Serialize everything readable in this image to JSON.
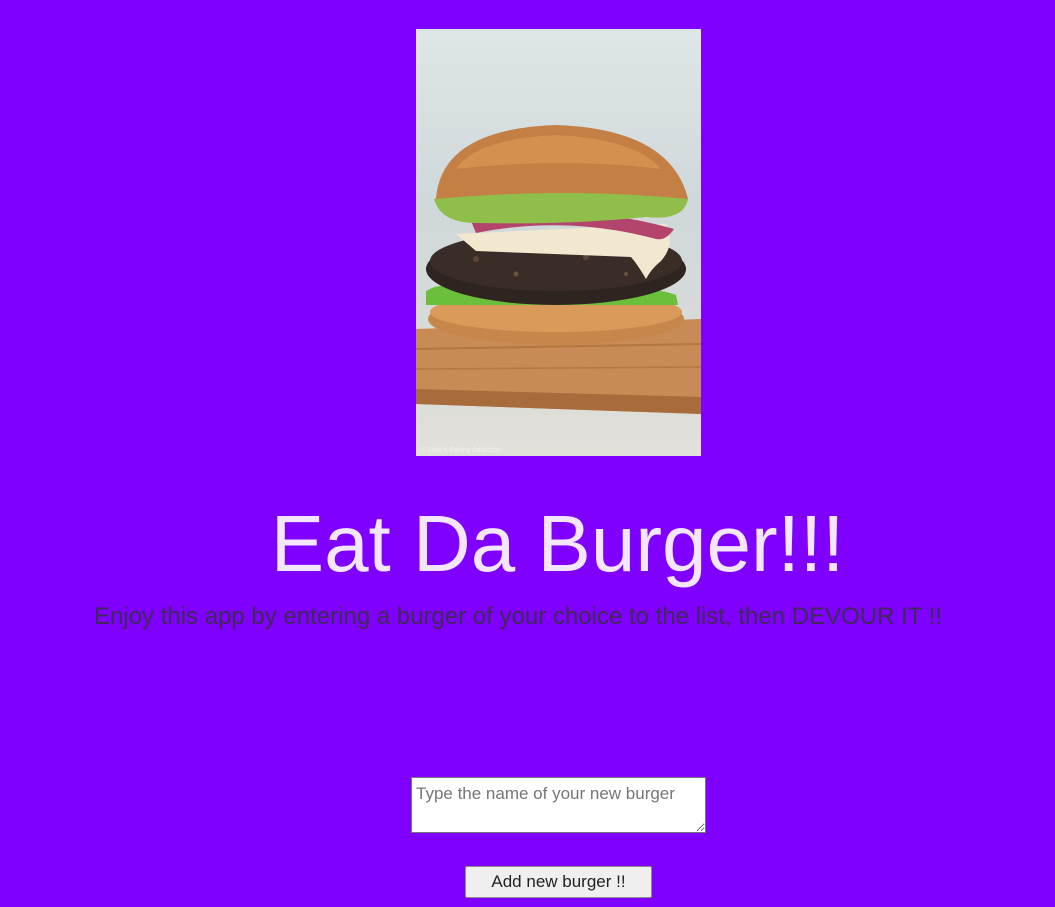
{
  "header": {
    "image_name": "burger-photo",
    "photo_credit": "© Sally's Baking Addiction"
  },
  "main": {
    "title": "Eat Da Burger!!!",
    "subtitle": "Enjoy this app by entering a burger of your choice to the list, then DEVOUR IT !!"
  },
  "form": {
    "input_placeholder": "Type the name of your new burger",
    "input_value": "",
    "submit_label": "Add new burger !!"
  },
  "colors": {
    "background": "#8000ff",
    "title": "#f5e6ff",
    "subtitle": "#3f2a55"
  }
}
